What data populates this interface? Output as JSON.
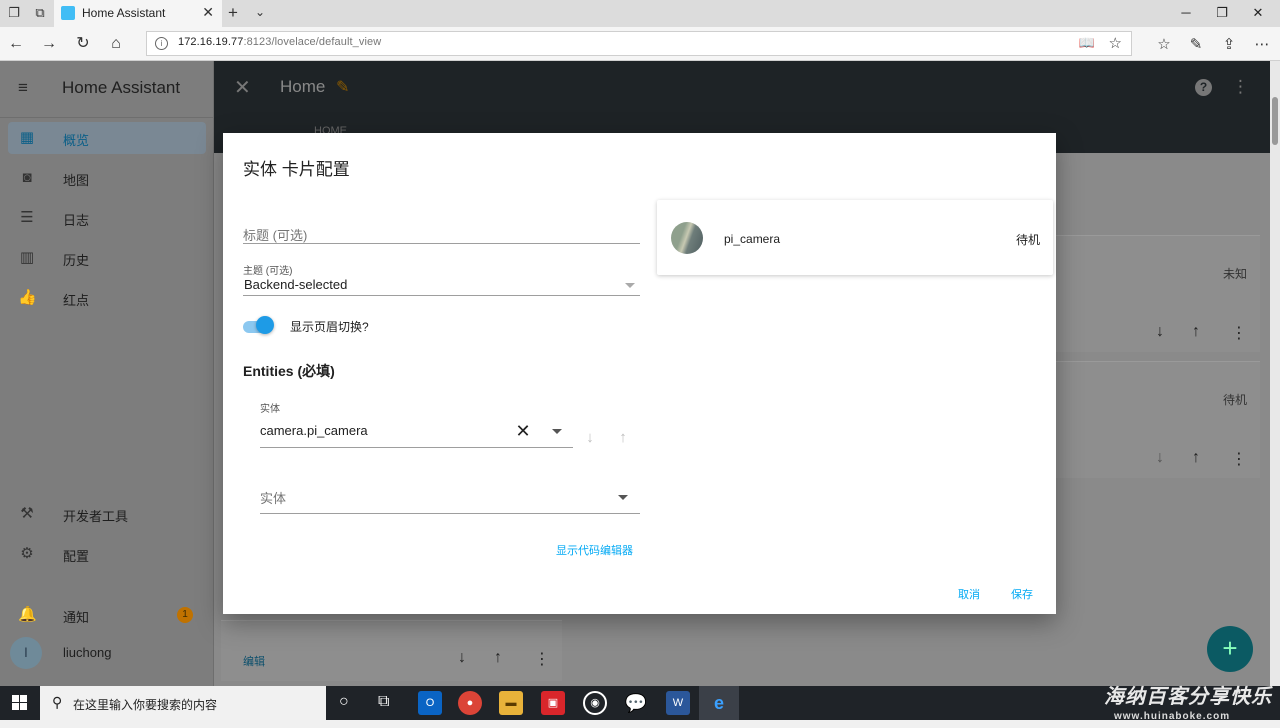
{
  "browser": {
    "tab_title": "Home Assistant",
    "url_host": "172.16.19.77",
    "url_path": ":8123/lovelace/default_view"
  },
  "sidebar": {
    "title": "Home Assistant",
    "items": [
      {
        "label": "概览",
        "icon": "grid-icon"
      },
      {
        "label": "地图",
        "icon": "map-icon"
      },
      {
        "label": "日志",
        "icon": "list-icon"
      },
      {
        "label": "历史",
        "icon": "chart-icon"
      },
      {
        "label": "红点",
        "icon": "thumb-icon"
      }
    ],
    "dev_tools": "开发者工具",
    "config": "配置",
    "notifications": "通知",
    "notifications_count": "1",
    "user_initial": "l",
    "user_name": "liuchong"
  },
  "toolbar": {
    "title": "Home",
    "subtitle": "HOME"
  },
  "background": {
    "state_unknown": "未知",
    "state_idle": "待机",
    "edit_label": "编辑"
  },
  "dialog": {
    "title": "实体 卡片配置",
    "title_placeholder": "标题 (可选)",
    "theme_label": "主题 (可选)",
    "theme_value": "Backend-selected",
    "toggle_label": "显示页眉切换?",
    "toggle_on": true,
    "entities_heading": "Entities (必填)",
    "entity_label": "实体",
    "entity_value": "camera.pi_camera",
    "new_entity_placeholder": "实体",
    "show_code_editor": "显示代码编辑器",
    "cancel": "取消",
    "save": "保存"
  },
  "preview": {
    "name": "pi_camera",
    "state": "待机"
  },
  "taskbar": {
    "search_placeholder": "在这里输入你要搜索的内容"
  },
  "watermark": {
    "text": "海纳百客分享快乐",
    "sub": "www.huinaboke.com"
  },
  "colors": {
    "accent": "#03a9f4",
    "toggle": "#1e9be6",
    "badge": "#c07200"
  }
}
